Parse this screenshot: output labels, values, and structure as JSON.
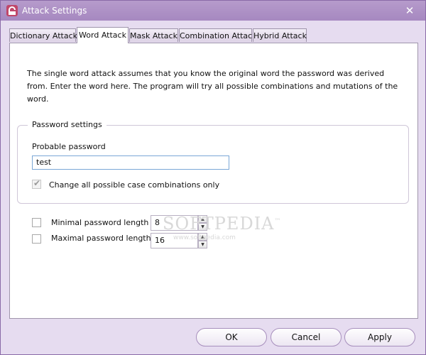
{
  "window": {
    "title": "Attack Settings",
    "close_glyph": "✕"
  },
  "tabs": [
    {
      "label": "Dictionary Attack"
    },
    {
      "label": "Word Attack"
    },
    {
      "label": "Mask Attack"
    },
    {
      "label": "Combination Attack"
    },
    {
      "label": "Hybrid Attack"
    }
  ],
  "active_tab": "Word Attack",
  "description": "The single word attack assumes that you know the original word the password was derived from. Enter the word here. The program will try all possible combinations and mutations of the word.",
  "password_settings": {
    "legend": "Password settings",
    "probable_label": "Probable password",
    "probable_value": "test",
    "case_label": "Change all possible case combinations only",
    "case_checked": true
  },
  "length_options": {
    "min_label": "Minimal password length",
    "min_value": "8",
    "min_checked": false,
    "max_label": "Maximal password length",
    "max_value": "16",
    "max_checked": false
  },
  "watermark": {
    "text": "SOFTPEDIA",
    "mark": "™",
    "sub": "www.softpedia.com"
  },
  "buttons": {
    "ok": "OK",
    "cancel": "Cancel",
    "apply": "Apply"
  },
  "colors": {
    "titlebar": "#a688c0",
    "window_bg": "#e6dcf0",
    "border": "#8a6aa8"
  }
}
